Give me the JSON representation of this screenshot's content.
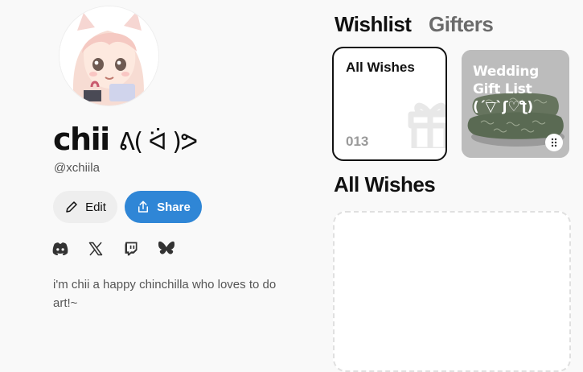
{
  "profile": {
    "display_name": "chii ",
    "display_name_kaomoji": "ᕕ( ᐛ )ᕗ",
    "handle": "@xchiila",
    "bio": "i'm chii a happy chinchilla who loves to do art!~",
    "avatar_icon": "anime-avatar"
  },
  "actions": {
    "edit_label": "Edit",
    "share_label": "Share"
  },
  "socials": [
    {
      "name": "discord",
      "icon": "discord-icon"
    },
    {
      "name": "x",
      "icon": "x-icon"
    },
    {
      "name": "twitch",
      "icon": "twitch-icon"
    },
    {
      "name": "bluesky",
      "icon": "bluesky-icon"
    }
  ],
  "tabs": [
    {
      "label": "Wishlist",
      "active": true
    },
    {
      "label": "Gifters",
      "active": false
    }
  ],
  "wishlists": [
    {
      "title": "All Wishes",
      "count": "013",
      "selected": true
    },
    {
      "title": "Wedding Gift List (´▽`ʃ♡ƪ)"
    }
  ],
  "section": {
    "title": "All Wishes"
  },
  "colors": {
    "accent": "#2f86d6",
    "background": "#f9f9f9",
    "muted_text": "#6b6b6b"
  }
}
